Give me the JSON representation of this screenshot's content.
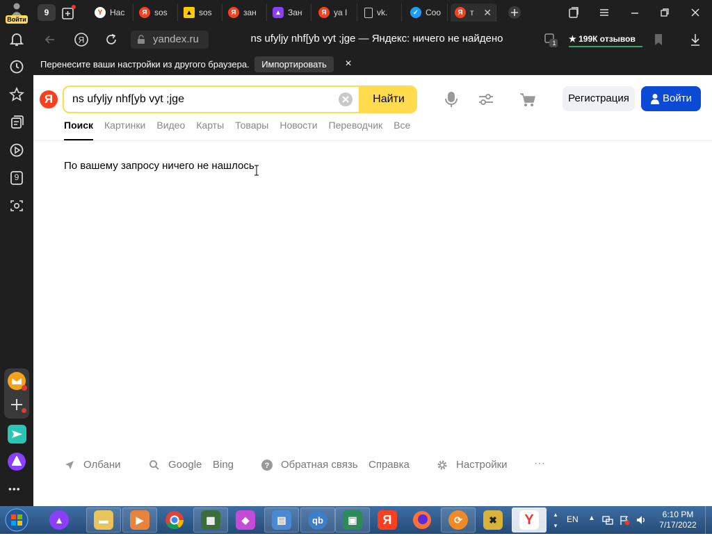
{
  "sidebar": {
    "login_label": "Войти",
    "tab_count": "9"
  },
  "tabs": {
    "count": "9",
    "items": [
      {
        "label": "Нас",
        "color": "#ffffff"
      },
      {
        "label": "sos",
        "color": "#fc3f1d"
      },
      {
        "label": "sos",
        "color": "#ffcc00"
      },
      {
        "label": "зан",
        "color": "#fc3f1d"
      },
      {
        "label": "Зан",
        "color": "#8a3ffc"
      },
      {
        "label": "ya I",
        "color": "#fc3f1d"
      },
      {
        "label": "vk.",
        "color": "#cccccc"
      },
      {
        "label": "Coo",
        "color": "#1a9fff"
      },
      {
        "label": "т",
        "color": "#fc3f1d"
      }
    ]
  },
  "address": {
    "domain": "yandex.ru",
    "page_title": "ns ufyljy nhf[yb vyt ;jge — Яндекс: ничего не найдено",
    "reviews": "199К отзывов",
    "badge_count": "1"
  },
  "infobar": {
    "message": "Перенесите ваши настройки из другого браузера.",
    "import_button": "Импортировать",
    "close": "×"
  },
  "search": {
    "logo_letter": "Я",
    "query": "ns ufyljy nhf[yb vyt ;jge",
    "submit": "Найти",
    "register": "Регистрация",
    "login": "Войти",
    "tabs": [
      "Поиск",
      "Картинки",
      "Видео",
      "Карты",
      "Товары",
      "Новости",
      "Переводчик",
      "Все"
    ],
    "result_message": "По вашему запросу ничего не нашлось"
  },
  "footer": {
    "location": "Олбани",
    "google": "Google",
    "bing": "Bing",
    "feedback": "Обратная связь",
    "help": "Справка",
    "settings": "Настройки",
    "more": "···"
  },
  "taskbar": {
    "lang": "EN",
    "time": "6:10 PM",
    "date": "7/17/2022"
  },
  "colors": {
    "yandex_red": "#fc3f1d",
    "search_yellow": "#ffdb4d",
    "login_blue": "#0a4ad5",
    "dark_chrome": "#1f1f1f"
  }
}
